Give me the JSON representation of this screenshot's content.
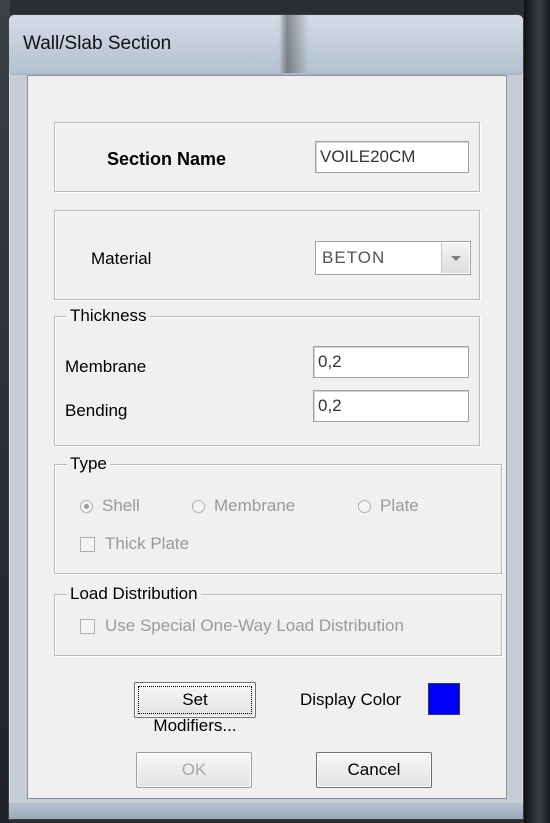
{
  "dialog": {
    "title": "Wall/Slab Section"
  },
  "section_name": {
    "label": "Section Name",
    "value": "VOILE20CM"
  },
  "material": {
    "label": "Material",
    "selected": "BETON"
  },
  "thickness": {
    "legend": "Thickness",
    "membrane_label": "Membrane",
    "membrane_value": "0,2",
    "bending_label": "Bending",
    "bending_value": "0,2"
  },
  "type": {
    "legend": "Type",
    "options": [
      "Shell",
      "Membrane",
      "Plate"
    ],
    "selected": "Shell",
    "thick_plate_label": "Thick Plate"
  },
  "load_distribution": {
    "legend": "Load Distribution",
    "checkbox_label": "Use Special One-Way Load Distribution"
  },
  "buttons": {
    "set_modifiers": "Set Modifiers...",
    "display_color_label": "Display Color",
    "display_color": "#0000ff",
    "ok": "OK",
    "cancel": "Cancel"
  }
}
